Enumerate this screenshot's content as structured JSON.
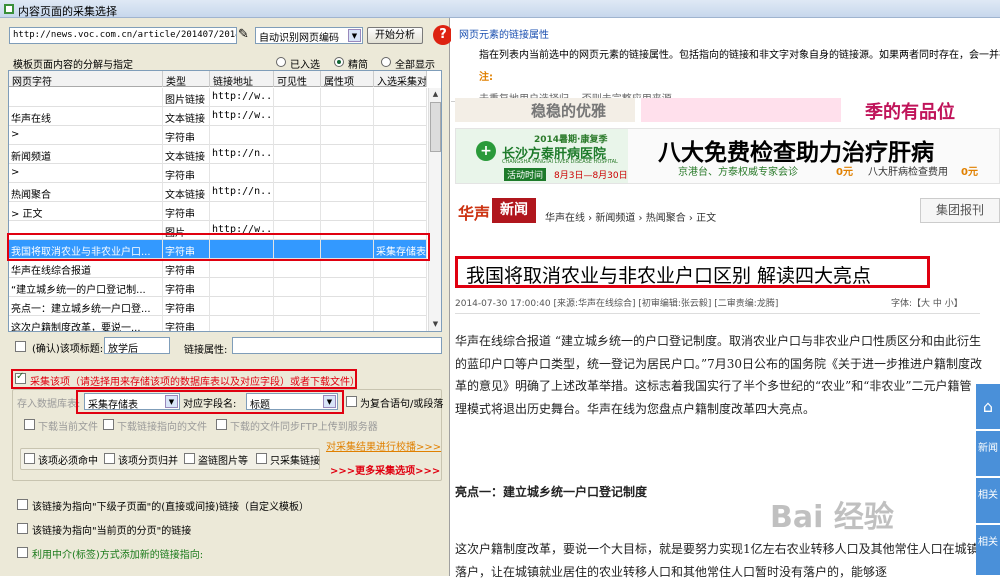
{
  "window": {
    "title": "内容页面的采集选择"
  },
  "toolbar": {
    "url": "http://news.voc.com.cn/article/201407/20140730",
    "encoding": "自动识别网页编码",
    "analyze": "开始分析",
    "help": "?"
  },
  "table": {
    "title": "模板页面内容的分解与指定",
    "radios": [
      {
        "label": "已入选",
        "checked": false
      },
      {
        "label": "精简",
        "checked": true
      },
      {
        "label": "全部显示",
        "checked": false
      }
    ],
    "columns": [
      "网页字符",
      "类型",
      "链接地址",
      "可见性",
      "属性项",
      "入选采集对"
    ],
    "rows": [
      [
        "",
        "图片链接",
        "http://w...",
        "",
        "",
        ""
      ],
      [
        "华声在线",
        "文本链接",
        "http://w...",
        "",
        "",
        ""
      ],
      [
        ">",
        "字符串",
        "",
        "",
        "",
        ""
      ],
      [
        "新闻频道",
        "文本链接",
        "http://n...",
        "",
        "",
        ""
      ],
      [
        ">",
        "字符串",
        "",
        "",
        "",
        ""
      ],
      [
        "热闻聚合",
        "文本链接",
        "http://n...",
        "",
        "",
        ""
      ],
      [
        "> 正文",
        "字符串",
        "",
        "",
        "",
        ""
      ],
      [
        "",
        "图片",
        "http://w...",
        "",
        "",
        ""
      ],
      [
        "我国将取消农业与非农业户口...",
        "字符串",
        "",
        "",
        "",
        "采集存储表"
      ],
      [
        "华声在线综合报道",
        "字符串",
        "",
        "",
        "",
        ""
      ],
      [
        "“建立城乡统一的户口登记制...",
        "字符串",
        "",
        "",
        "",
        ""
      ],
      [
        "亮点一：建立城乡统一户口登...",
        "字符串",
        "",
        "",
        "",
        ""
      ],
      [
        "这次户籍制度改革，要说一...",
        "字符串",
        "",
        "",
        "",
        ""
      ]
    ],
    "selected_row": 8
  },
  "options": {
    "confirm_title_label": "(确认)该项标题:",
    "confirm_title_value": "放学后",
    "link_attr_label": "链接属性:",
    "collect_label": "采集该项（请选择用来存储该项的数据库表以及对应字段）或者下载文件）",
    "store_table_label": "存入数据库表:",
    "store_table_value": "采集存储表",
    "field_label": "对应字段名:",
    "field_value": "标题",
    "compound_label": "为复合语句/或段落",
    "download_current": "下载当前文件",
    "download_linked": "下载链接指向的文件",
    "ftp_upload": "下载的文件同步FTP上传到服务器",
    "post_process": "对采集结果进行校播>>>",
    "must_collect": "该项必须命中",
    "split_merge": "该项分页归并",
    "steal_img": "盗链图片等",
    "collect_link_only": "只采集链接",
    "more_options": ">>>更多采集选项>>>",
    "opt_child": "该链接为指向\"下级子页面\"的(直接或间接)链接（自定义模板）",
    "opt_page": "该链接为指向\"当前页的分页\"的链接",
    "opt_mediate": "利用中介(标签)方式添加新的链接指向:"
  },
  "info": {
    "title": "网页元素的链接属性",
    "text": "指在列表内当前选中的网页元素的链接属性。包括指向的链接和非文字对象自身的链接源。如果两者同时存在，会一并在",
    "note": "注:",
    "extra": "去重复地用户选择归... 否则未完整应用来源"
  },
  "ads": {
    "banner1_left": "稳稳的优雅",
    "banner1_right": "季的有品位",
    "hospital_year": "2014暑期·康复季",
    "hospital_name": "长沙方泰肝病医院",
    "hospital_en": "CHANGSHA FANGTAI LIVER DISEASE HOSPITAL",
    "hospital_date_label": "活动时间",
    "hospital_date": "8月3日—8月30日",
    "big_title": "八大免费检查助力治疗肝病",
    "sub_left": "京港台、方泰权威专家会诊",
    "sub_left_price": "0元",
    "sub_right": "八大肝病检查费用",
    "sub_right_price": "0元"
  },
  "article": {
    "logo": "华声",
    "nav_label": "新闻",
    "breadcrumb": [
      "华声在线",
      "新闻频道",
      "热闻聚合",
      "正文"
    ],
    "search": "集团报刊",
    "headline": "我国将取消农业与非农业户口区别 解读四大亮点",
    "meta": "2014-07-30 17:00:40 [来源:华声在线综合] [初审编辑:张云毅] [二审责编:龙腾]",
    "font_label": "字体:【大 中 小】",
    "para1": "华声在线综合报道  “建立城乡统一的户口登记制度。取消农业户口与非农业户口性质区分和由此衍生的蓝印户口等户口类型，统一登记为居民户口。”7月30日公布的国务院《关于进一步推进户籍制度改革的意见》明确了上述改革举措。这标志着我国实行了半个多世纪的“农业”和“非农业”二元户籍管理模式将退出历史舞台。华声在线为您盘点户籍制度改革四大亮点。",
    "section1": "亮点一：建立城乡统一户口登记制度",
    "para2": "这次户籍制度改革，要说一个大目标，就是要努力实现1亿左右农业转移人口及其他常住人口在城镇落户，让在城镇就业居住的农业转移人口和其他常住人口暂时没有落户的，能够逐"
  },
  "sidetools": [
    "新闻",
    "相关",
    "相关"
  ],
  "watermark": "Bai 经验",
  "colors": {
    "highlight": "#e00010",
    "selection": "#3399ff",
    "brand_red": "#b0161d"
  }
}
